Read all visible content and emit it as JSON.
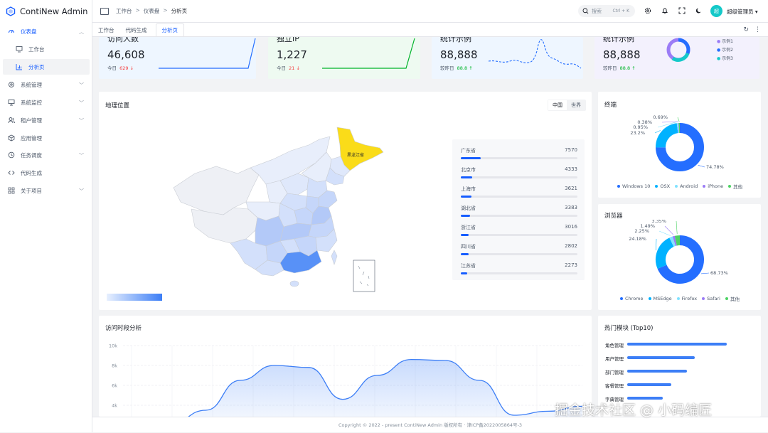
{
  "app": {
    "title": "ContiNew Admin"
  },
  "sidebar": {
    "items": [
      {
        "label": "仪表盘",
        "icon": "dashboard-icon"
      },
      {
        "label": "工作台",
        "icon": "monitor-icon"
      },
      {
        "label": "分析页",
        "icon": "bar-chart-icon"
      },
      {
        "label": "系统管理",
        "icon": "settings-icon"
      },
      {
        "label": "系统监控",
        "icon": "screen-icon"
      },
      {
        "label": "租户管理",
        "icon": "users-icon"
      },
      {
        "label": "应用管理",
        "icon": "cube-icon"
      },
      {
        "label": "任务调度",
        "icon": "clock-icon"
      },
      {
        "label": "代码生成",
        "icon": "code-icon"
      },
      {
        "label": "关于项目",
        "icon": "apps-icon"
      }
    ]
  },
  "header": {
    "breadcrumb": [
      "工作台",
      "仪表盘",
      "分析页"
    ],
    "search_placeholder": "搜索",
    "search_shortcut": "Ctrl + K",
    "avatar_text": "超",
    "username": "超级管理员"
  },
  "tabs": [
    "工作台",
    "代码生成",
    "分析页"
  ],
  "stats": [
    {
      "title": "访问人数",
      "value": "46,608",
      "sub_label": "今日",
      "delta": "629",
      "dir": "down"
    },
    {
      "title": "独立IP",
      "value": "1,227",
      "sub_label": "今日",
      "delta": "21",
      "dir": "down"
    },
    {
      "title": "统计示例",
      "value": "88,888",
      "sub_label": "较昨日",
      "delta": "88.8",
      "dir": "up"
    },
    {
      "title": "统计示例",
      "value": "88,888",
      "sub_label": "较昨日",
      "delta": "88.8",
      "dir": "up"
    }
  ],
  "stat_legend": [
    "示例1",
    "示例2",
    "示例3"
  ],
  "geo": {
    "title": "地理位置",
    "toggle": [
      "中国",
      "世界"
    ],
    "highlight": "黑龙江省",
    "ranking": [
      {
        "name": "广东省",
        "value": "7570",
        "pct": 0.17
      },
      {
        "name": "北京市",
        "value": "4333",
        "pct": 0.1
      },
      {
        "name": "上海市",
        "value": "3621",
        "pct": 0.09
      },
      {
        "name": "湖北省",
        "value": "3383",
        "pct": 0.08
      },
      {
        "name": "浙江省",
        "value": "3016",
        "pct": 0.07
      },
      {
        "name": "四川省",
        "value": "2802",
        "pct": 0.065
      },
      {
        "name": "江苏省",
        "value": "2273",
        "pct": 0.055
      }
    ]
  },
  "terminal": {
    "title": "终端",
    "chart_data": {
      "type": "pie",
      "labels": [
        "Windows 10",
        "OSX",
        "Android",
        "iPhone",
        "其他"
      ],
      "values": [
        74.78,
        23.2,
        0.95,
        0.38,
        0.69
      ],
      "value_labels": [
        "74.78%",
        "23.2%",
        "0.95%",
        "0.38%",
        "0.69%"
      ],
      "colors": [
        "#246eff",
        "#00b2ff",
        "#81e2ff",
        "#9b7cf6",
        "#4cd263"
      ]
    }
  },
  "browser": {
    "title": "浏览器",
    "chart_data": {
      "type": "pie",
      "labels": [
        "Chrome",
        "MSEdge",
        "Firefox",
        "Safari",
        "其他"
      ],
      "values": [
        68.73,
        24.18,
        2.25,
        1.49,
        3.35
      ],
      "value_labels": [
        "68.73%",
        "24.18%",
        "2.25%",
        "1.49%",
        "3.35%"
      ],
      "colors": [
        "#246eff",
        "#00b2ff",
        "#81e2ff",
        "#9b7cf6",
        "#4cd263"
      ]
    }
  },
  "visits": {
    "title": "访问时段分析",
    "chart_data": {
      "type": "area",
      "yticks": [
        "10k",
        "8k",
        "6k",
        "4k"
      ],
      "ylim": [
        4000,
        10000
      ],
      "values": [
        2000,
        2200,
        3500,
        6500,
        8000,
        7800,
        4600,
        7000,
        8600,
        8500,
        6500,
        3000,
        3400,
        3900
      ]
    }
  },
  "hot": {
    "title": "热门模块 (Top10)",
    "chart_data": {
      "type": "bar",
      "categories": [
        "角色管理",
        "用户管理",
        "部门管理",
        "客餐管理",
        "字典管理"
      ],
      "values": [
        100,
        68,
        60,
        44,
        36
      ]
    }
  },
  "footer": {
    "text": "Copyright © 2022 - present ContiNew Admin 版权所有 · 津ICP备2022005864号-3"
  },
  "watermark": "掘金技术社区 @ 小码编匠"
}
